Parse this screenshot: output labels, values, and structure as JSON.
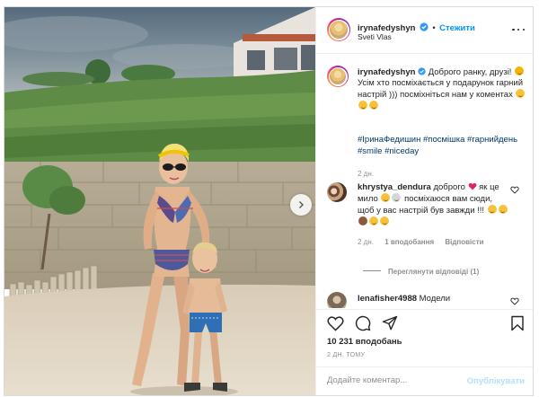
{
  "post": {
    "username": "irynafedyshyn",
    "follow_label": "Стежити",
    "location": "Sveti Vlas"
  },
  "caption": {
    "username": "irynafedyshyn",
    "text_1": "Доброго ранку, друзі!",
    "text_2": "Усім хто посміхається у подарунок гарний настрій ))) посміхніться нам у коментах",
    "hashtags": [
      "#ІринаФедишин",
      "#посмішка",
      "#гарнийдень",
      "#smile",
      "#niceday"
    ],
    "age": "2 дн."
  },
  "comments": [
    {
      "username": "khrystya_dendura",
      "text_1": "доброго",
      "text_2": "як це мило",
      "text_3": "посміхаюся вам сюди, щоб у вас настрій був завжди !!!",
      "age": "2 дн.",
      "likes_label": "1 вподобання",
      "reply_label": "Відповісти",
      "view_replies_label": "Переглянути відповіді (1)"
    },
    {
      "username": "lenafisher4988",
      "text_1": "Модели"
    }
  ],
  "actions": {
    "likes_count": "10 231 вподобань",
    "timestamp": "2 ДН. ТОМУ"
  },
  "composer": {
    "placeholder": "Додайте коментар...",
    "publish_label": "Опублікувати"
  },
  "colors": {
    "link_blue": "#0095f6",
    "hashtag": "#00376b",
    "muted": "#8e8e8e",
    "publish_disabled": "#b2dffc"
  },
  "icons": [
    "verified-badge-icon",
    "more-options-icon",
    "heart-icon",
    "comment-icon",
    "share-icon",
    "bookmark-icon",
    "next-arrow-icon"
  ]
}
